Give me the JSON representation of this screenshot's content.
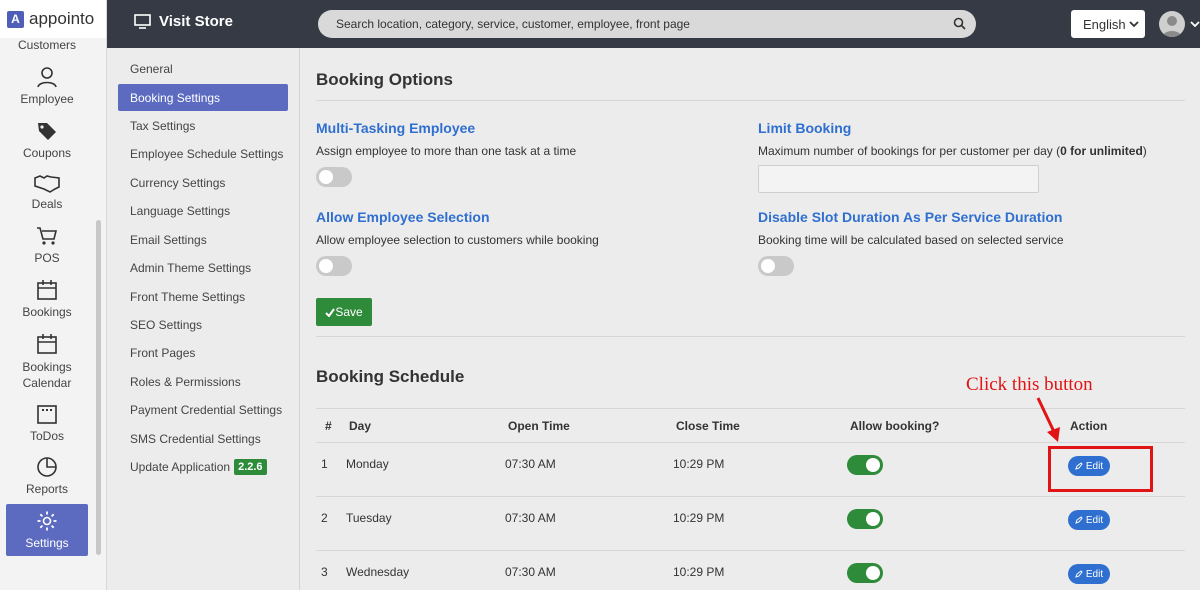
{
  "brand": {
    "name": "appointo",
    "logo_letter": "A"
  },
  "rail": {
    "items": [
      {
        "label": "Customers",
        "icon": "customers-icon"
      },
      {
        "label": "Employee",
        "icon": "user-icon"
      },
      {
        "label": "Coupons",
        "icon": "tag-icon"
      },
      {
        "label": "Deals",
        "icon": "handshake-icon"
      },
      {
        "label": "POS",
        "icon": "cart-icon"
      },
      {
        "label": "Bookings",
        "icon": "calendar-icon"
      },
      {
        "label": "Bookings Calendar",
        "icon": "calendar-icon"
      },
      {
        "label": "ToDos",
        "icon": "calendar-grid-icon"
      },
      {
        "label": "Reports",
        "icon": "pie-chart-icon"
      },
      {
        "label": "Settings",
        "icon": "gear-icon"
      }
    ]
  },
  "topbar": {
    "visit_store": "Visit Store",
    "search_placeholder": "Search location, category, service, customer, employee, front page",
    "language": "English"
  },
  "submenu": {
    "items": [
      "General",
      "Booking Settings",
      "Tax Settings",
      "Employee Schedule Settings",
      "Currency Settings",
      "Language Settings",
      "Email Settings",
      "Admin Theme Settings",
      "Front Theme Settings",
      "SEO Settings",
      "Front Pages",
      "Roles & Permissions",
      "Payment Credential Settings",
      "SMS Credential Settings",
      "Update Application"
    ],
    "version": "2.2.6"
  },
  "booking_options": {
    "title": "Booking Options",
    "multi_tasking": {
      "title": "Multi-Tasking Employee",
      "desc": "Assign employee to more than one task at a time"
    },
    "limit_booking": {
      "title": "Limit Booking",
      "desc_prefix": "Maximum number of bookings for per customer per day (",
      "desc_bold": "0 for unlimited",
      "desc_suffix": ")",
      "value": ""
    },
    "allow_selection": {
      "title": "Allow Employee Selection",
      "desc": "Allow employee selection to customers while booking"
    },
    "disable_slot": {
      "title": "Disable Slot Duration As Per Service Duration",
      "desc": "Booking time will be calculated based on selected service"
    },
    "save_label": "Save"
  },
  "schedule": {
    "title": "Booking Schedule",
    "headers": {
      "num": "#",
      "day": "Day",
      "open": "Open Time",
      "close": "Close Time",
      "allow": "Allow booking?",
      "action": "Action"
    },
    "rows": [
      {
        "num": "1",
        "day": "Monday",
        "open": "07:30 AM",
        "close": "10:29 PM",
        "edit": "Edit"
      },
      {
        "num": "2",
        "day": "Tuesday",
        "open": "07:30 AM",
        "close": "10:29 PM",
        "edit": "Edit"
      },
      {
        "num": "3",
        "day": "Wednesday",
        "open": "07:30 AM",
        "close": "10:29 PM",
        "edit": "Edit"
      }
    ]
  },
  "annotation": {
    "text": "Click this button",
    "color": "#e01414"
  },
  "colors": {
    "accent": "#5c6bc0",
    "topbar": "#353a45",
    "success": "#2e8b3a",
    "link": "#2f6fd0"
  }
}
